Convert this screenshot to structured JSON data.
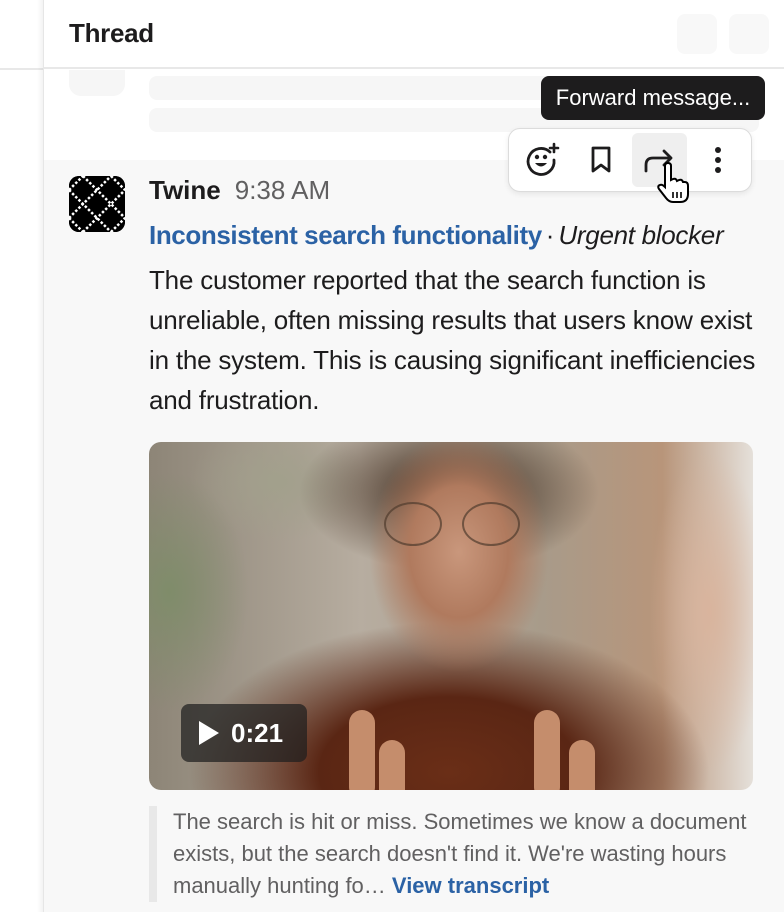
{
  "header": {
    "title": "Thread"
  },
  "message": {
    "sender": "Twine",
    "timestamp": "9:38 AM",
    "issue_title": "Inconsistent search functionality",
    "separator": "·",
    "priority": "Urgent blocker",
    "body": "The customer reported that the search function is unreliable, often missing results that users know exist in the system. This is causing significant inefficiencies and frustration.",
    "video": {
      "duration": "0:21",
      "play_icon": "play-icon"
    },
    "quote": {
      "text": "The search is hit or miss. Sometimes we know a document exists, but the search doesn't find it. We're wasting hours manually hunting fo…",
      "link_label": "View transcript"
    }
  },
  "toolbar": {
    "actions": [
      {
        "name": "add-reaction",
        "icon": "emoji-add-icon"
      },
      {
        "name": "save",
        "icon": "bookmark-icon"
      },
      {
        "name": "forward",
        "icon": "forward-arrow-icon",
        "active": true
      },
      {
        "name": "more",
        "icon": "more-vertical-icon"
      }
    ],
    "tooltip": "Forward message..."
  },
  "colors": {
    "link": "#2b62a5",
    "text": "#1d1c1d",
    "muted": "#616061",
    "message_bg": "#f8f8f8",
    "tooltip_bg": "#1d1c1d"
  }
}
